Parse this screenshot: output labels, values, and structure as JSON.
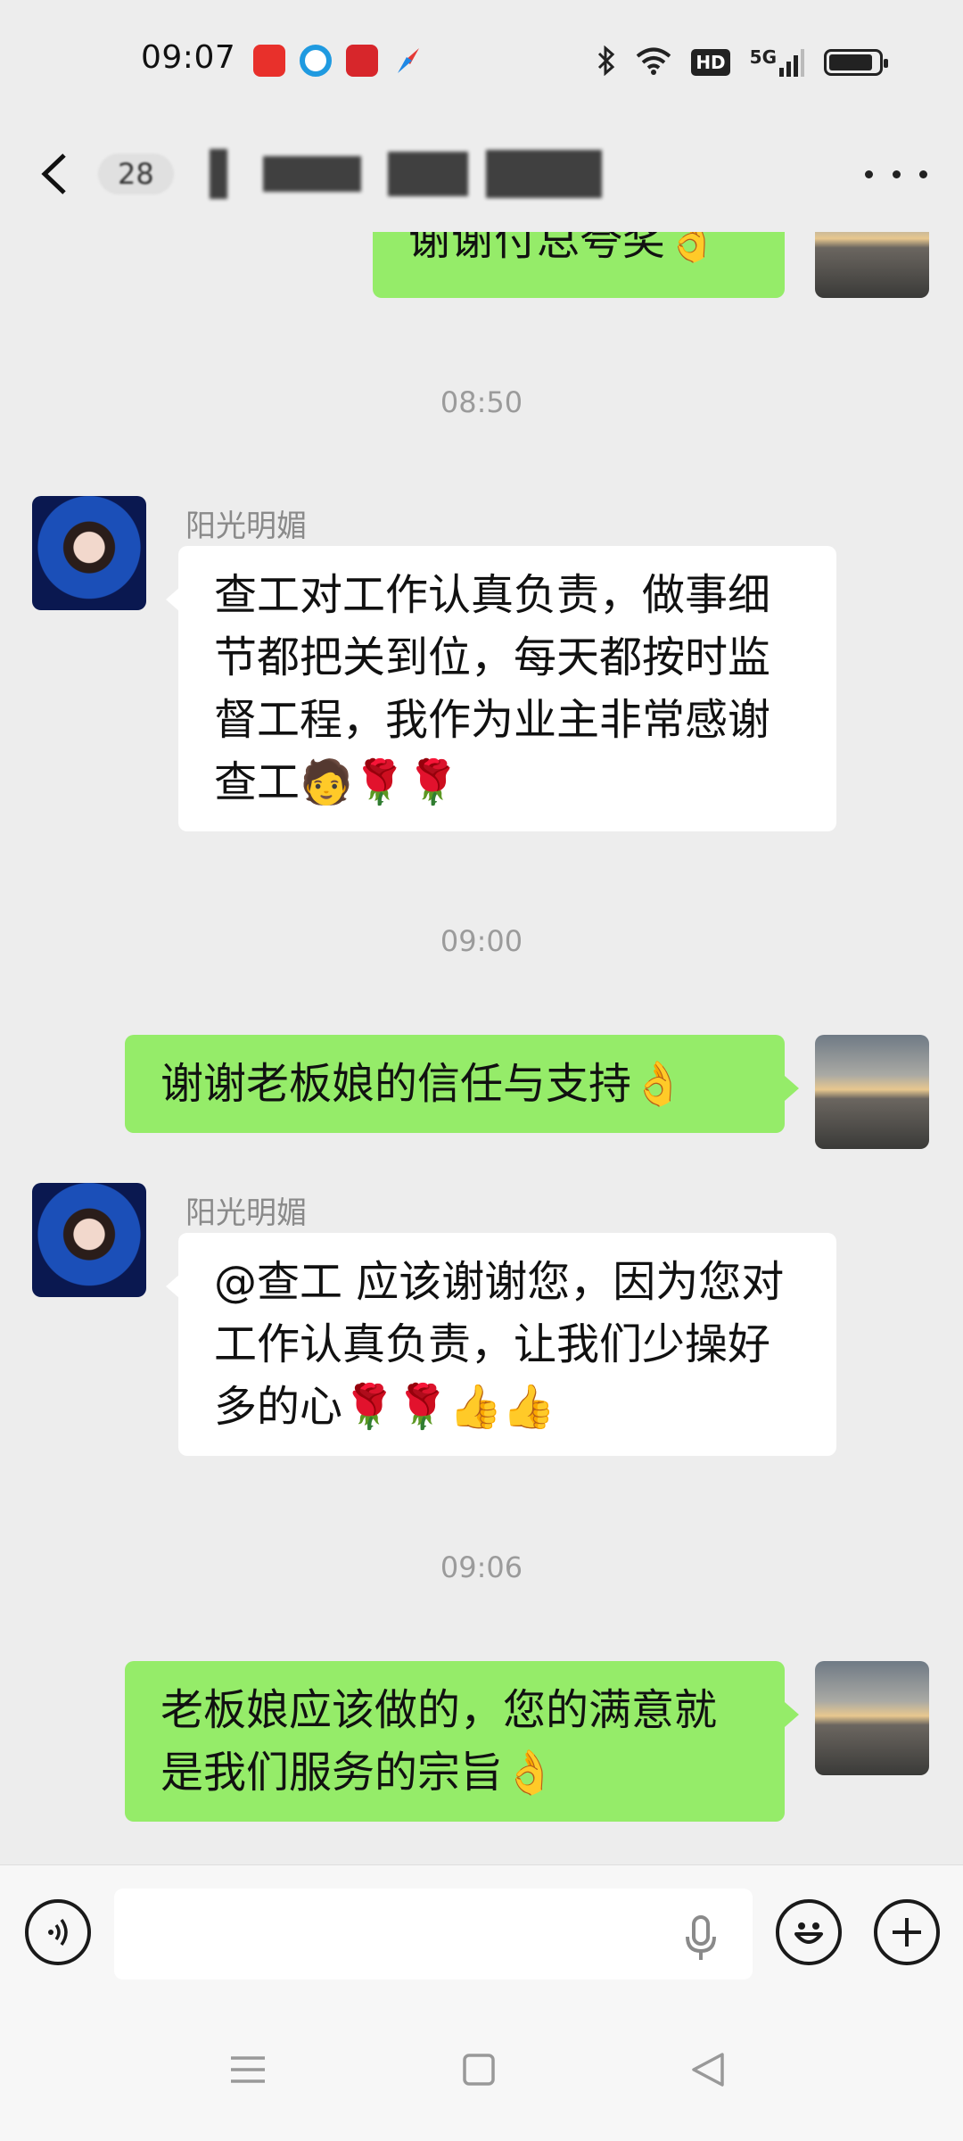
{
  "status_bar": {
    "time": "09:07",
    "app_icons": [
      "health-app-icon",
      "browser-app-icon",
      "byd-app-icon",
      "compass-app-icon"
    ],
    "indicators": {
      "hd": "HD",
      "network": "5G"
    }
  },
  "header": {
    "title_visible": "28"
  },
  "messages": {
    "m0": {
      "text": "谢谢付总夸奖👌"
    },
    "t1": "08:50",
    "m1": {
      "sender": "阳光明媚",
      "text": "查工对工作认真负责，做事细节都把关到位，每天都按时监督工程，我作为业主非常感谢查工🧑🌹🌹"
    },
    "t2": "09:00",
    "m2": {
      "text": "谢谢老板娘的信任与支持👌"
    },
    "m3": {
      "sender": "阳光明媚",
      "text": "@查工  应该谢谢您，因为您对工作认真负责，让我们少操好多的心🌹🌹👍👍"
    },
    "t3": "09:06",
    "m4": {
      "text": "老板娘应该做的，您的满意就是我们服务的宗旨👌"
    }
  },
  "input_bar": {
    "text_value": "",
    "placeholder": ""
  },
  "colors": {
    "background": "#ededed",
    "outgoing_bubble": "#95ec69",
    "incoming_bubble": "#ffffff",
    "timestamp": "#9b9b9b"
  }
}
